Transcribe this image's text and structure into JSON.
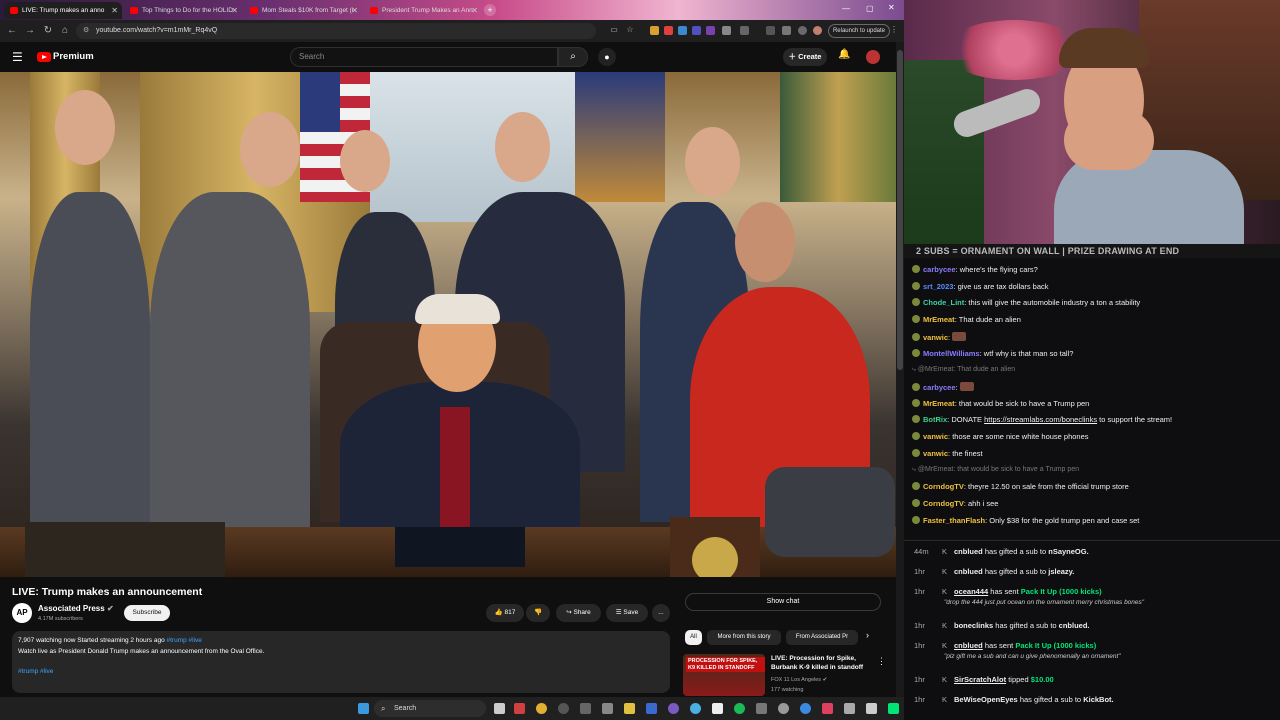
{
  "browser": {
    "tabs": [
      {
        "label": "LIVE: Trump makes an anno",
        "active": true
      },
      {
        "label": "Top Things to Do for the HOLID",
        "active": false
      },
      {
        "label": "Mom Steals $10K from Target (i",
        "active": false
      },
      {
        "label": "President Trump Makes an Ann",
        "active": false
      }
    ],
    "url": "youtube.com/watch?v=m1mMr_Rq4vQ",
    "relaunch_label": "Relaunch to update"
  },
  "youtube": {
    "brand": "Premium",
    "search_placeholder": "Search",
    "create_label": "Create",
    "video": {
      "title": "LIVE: Trump makes an announcement",
      "channel": "Associated Press",
      "channel_logo": "AP",
      "subscribers": "4.17M subscribers",
      "subscribe_label": "Subscribe",
      "likes": "817",
      "share_label": "Share",
      "save_label": "Save",
      "more_label": "...",
      "stats": "7,907 watching now  Started streaming 2 hours ago",
      "stats_tags": "#trump #live",
      "description": "Watch live as President Donald Trump makes an announcement from the Oval Office.",
      "tags": "#trump #live"
    },
    "show_chat_label": "Show chat",
    "chips": [
      "All",
      "More from this story",
      "From Associated Pr"
    ],
    "recommendation": {
      "thumb_text": "PROCESSION FOR SPIKE, K9 KILLED IN STANDOFF",
      "title": "LIVE: Procession for Spike, Burbank K-9 killed in standoff",
      "channel": "FOX 11 Los Angeles",
      "watching": "177 watching"
    }
  },
  "taskbar": {
    "search_placeholder": "Search"
  },
  "stream": {
    "banner": "2 SUBS = ORNAMENT ON WALL | PRIZE DRAWING AT END"
  },
  "chat": [
    {
      "user": "carbycee",
      "text": "where's the flying cars?",
      "color": "#8a7dff"
    },
    {
      "user": "srt_2023",
      "text": "give us are tax dollars back",
      "color": "#5b8cff"
    },
    {
      "user": "Chode_Lint",
      "text": "this will give the automobile industry a ton a stability",
      "color": "#3fd0a8"
    },
    {
      "user": "MrEmeat",
      "text": "That dude an alien",
      "color": "#f0c040"
    },
    {
      "user": "vanwic",
      "text": "",
      "color": "#f0c040"
    },
    {
      "user": "MontellWilliams",
      "text": "wtf why is that man so tall?",
      "color": "#8a7dff"
    },
    {
      "reply": "@MrEmeat: That dude an alien"
    },
    {
      "user": "carbycee",
      "text": "",
      "color": "#8a7dff"
    },
    {
      "user": "MrEmeat",
      "text": "that would be sick to have a Trump pen",
      "color": "#f0c040"
    },
    {
      "user": "BotRix",
      "text": "DONATE ",
      "link": "https://streamlabs.com/boneclinks",
      "after": " to support the stream!",
      "color": "#3fd08a"
    },
    {
      "user": "vanwic",
      "text": "those are some nice white house phones",
      "color": "#f0c040"
    },
    {
      "user": "vanwic",
      "text": "the finest",
      "color": "#f0c040"
    },
    {
      "reply": "@MrEmeat: that would be sick to have a Trump pen"
    },
    {
      "user": "CorndogTV",
      "text": "theyre 12.50 on sale from the official trump store",
      "color": "#f0c040"
    },
    {
      "user": "CorndogTV",
      "text": "ahh i see",
      "color": "#f0c040"
    },
    {
      "user": "Faster_thanFlash",
      "text": "Only $38 for the gold trump pen and case set",
      "color": "#f0c040"
    }
  ],
  "events": [
    {
      "time": "44m",
      "user": "cnblued",
      "text": "has gifted a sub to",
      "target": "nSayneOG."
    },
    {
      "time": "1hr",
      "user": "cnblued",
      "text": "has gifted a sub to",
      "target": "jsleazy."
    },
    {
      "time": "1hr",
      "user": "ocean444",
      "text": "has sent",
      "green": "Pack It Up (1000 kicks)",
      "sub": "\"drop the 444 just put ocean on the ornament merry christmas bones\""
    },
    {
      "time": "1hr",
      "user": "boneclinks",
      "text": "has gifted a sub to",
      "target": "cnblued."
    },
    {
      "time": "1hr",
      "user": "cnblued",
      "text": "has sent",
      "green": "Pack It Up (1000 kicks)",
      "sub": "\"plz gift me a sub and can u give phenomenally an ornament\""
    },
    {
      "time": "1hr",
      "user": "SirScratchAlot",
      "text": "tipped",
      "green": "$10.00"
    },
    {
      "time": "1hr",
      "user": "BeWiseOpenEyes",
      "text": "has gifted a sub to",
      "target": "KickBot."
    }
  ],
  "colors": {
    "yt_red": "#ff0000",
    "link_blue": "#3ea6ff",
    "kick_green": "#00e676",
    "bg": "#0f0f0f"
  }
}
